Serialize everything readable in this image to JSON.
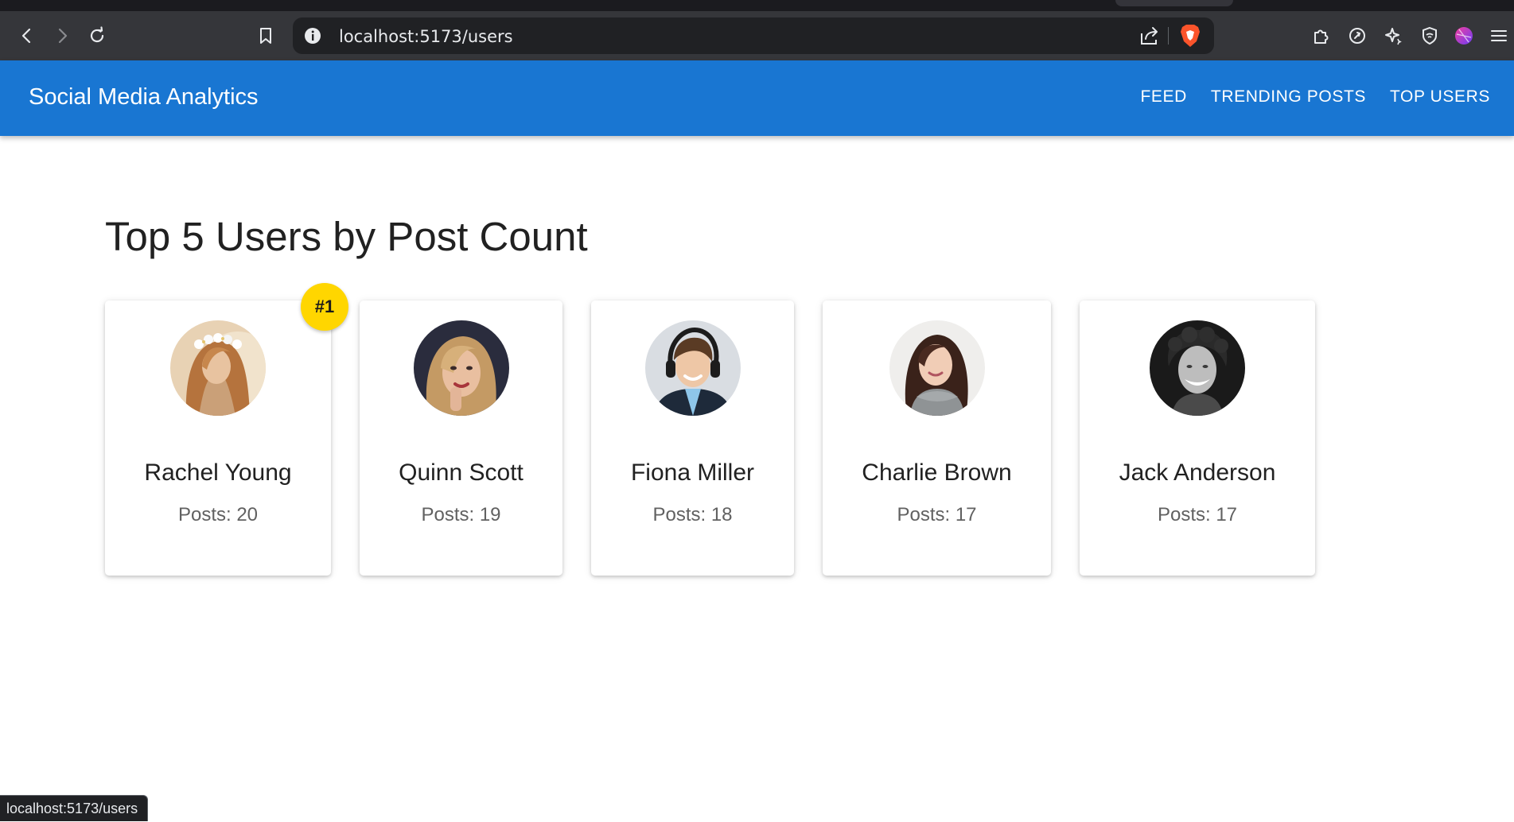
{
  "browser": {
    "url": "localhost:5173/users",
    "status_url": "localhost:5173/users"
  },
  "appbar": {
    "title": "Social Media Analytics",
    "nav": [
      {
        "label": "FEED"
      },
      {
        "label": "TRENDING POSTS"
      },
      {
        "label": "TOP USERS"
      }
    ]
  },
  "main": {
    "heading": "Top 5 Users by Post Count",
    "rank_badge": "#1",
    "users": [
      {
        "name": "Rachel Young",
        "posts": "Posts: 20"
      },
      {
        "name": "Quinn Scott",
        "posts": "Posts: 19"
      },
      {
        "name": "Fiona Miller",
        "posts": "Posts: 18"
      },
      {
        "name": "Charlie Brown",
        "posts": "Posts: 17"
      },
      {
        "name": "Jack Anderson",
        "posts": "Posts: 17"
      }
    ]
  },
  "colors": {
    "appbar": "#1976d2",
    "badge": "#ffd600",
    "browser_toolbar": "#35363a"
  }
}
